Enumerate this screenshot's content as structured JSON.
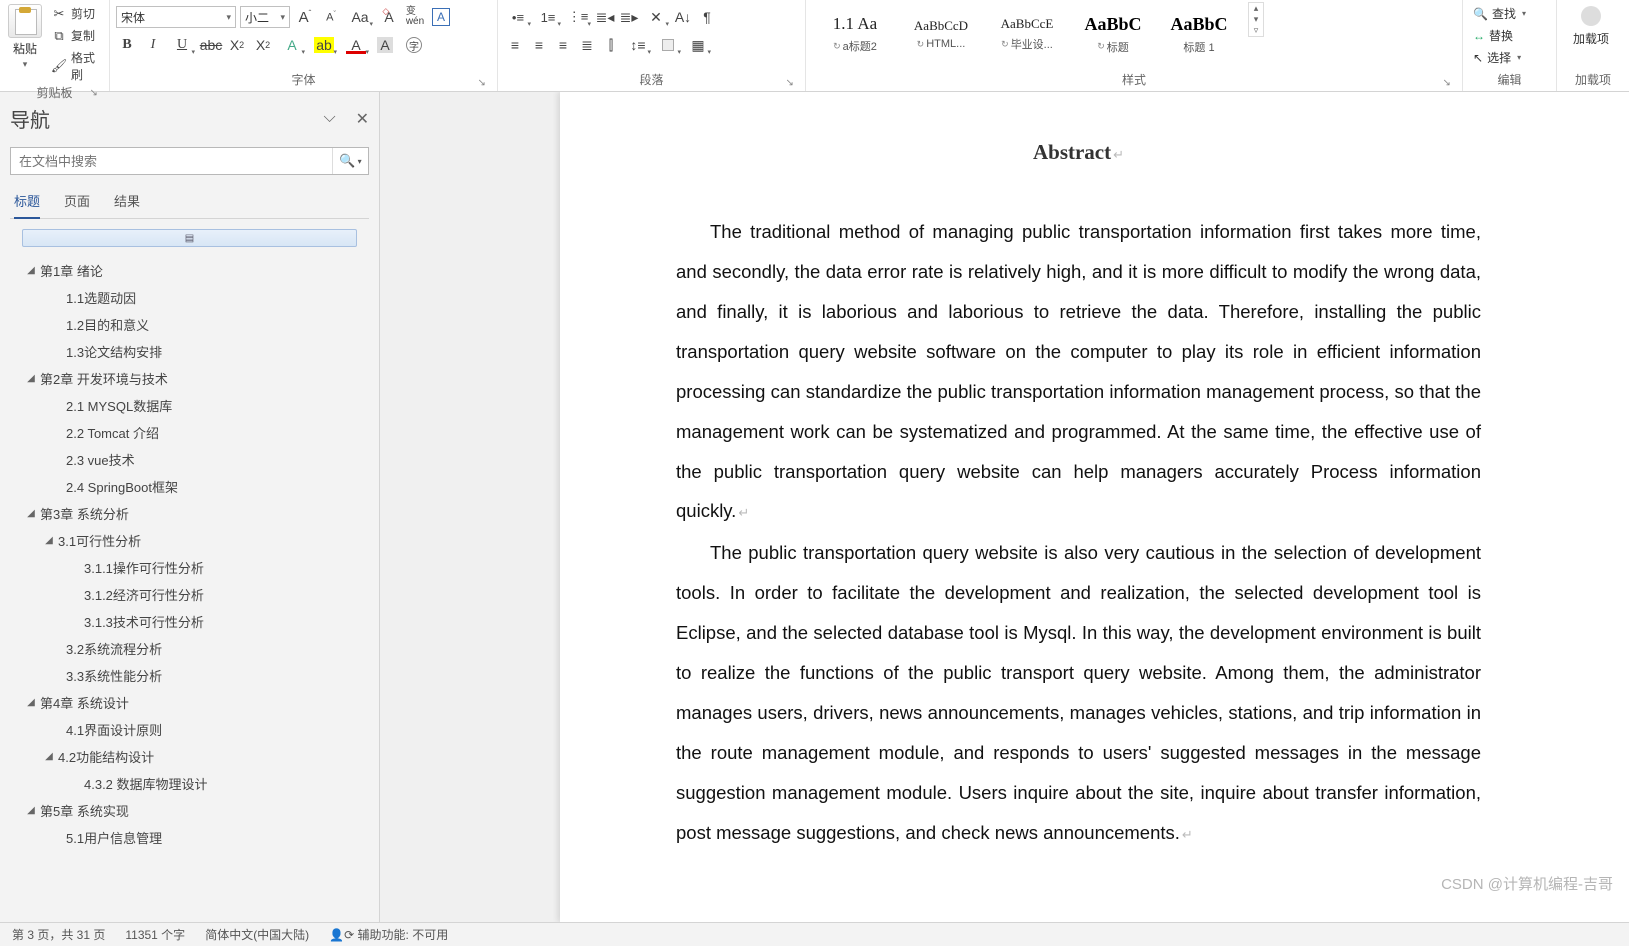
{
  "ribbon": {
    "clipboard": {
      "label": "剪贴板",
      "paste": "粘贴",
      "cut": "剪切",
      "copy": "复制",
      "formatPainter": "格式刷"
    },
    "font": {
      "label": "字体",
      "fontName": "宋体",
      "fontSize": "小二",
      "btns": {
        "bold": "B",
        "italic": "I",
        "underline": "U",
        "strike": "abc",
        "sub": "X",
        "sup": "X",
        "grow": "A",
        "shrink": "A",
        "changeCase": "Aa",
        "phonetic": "wén",
        "charBorder": "A",
        "clearFmt": "A",
        "textEffects": "A",
        "highlight": "ab",
        "fontColor": "A",
        "charShading": "A"
      }
    },
    "paragraph": {
      "label": "段落"
    },
    "styles": {
      "label": "样式",
      "items": [
        {
          "preview": "1.1 Aa",
          "name": "a标题2",
          "size": "17px",
          "weight": "normal",
          "color": "#222",
          "refresh": true
        },
        {
          "preview": "AaBbCcD",
          "name": "HTML...",
          "size": "13px",
          "weight": "normal",
          "color": "#222",
          "refresh": true
        },
        {
          "preview": "AaBbCcE",
          "name": "毕业设...",
          "size": "13px",
          "weight": "normal",
          "color": "#222",
          "refresh": true
        },
        {
          "preview": "AaBbC",
          "name": "标题",
          "size": "18px",
          "weight": "bold",
          "color": "#000",
          "refresh": true
        },
        {
          "preview": "AaBbC",
          "name": "标题 1",
          "size": "18px",
          "weight": "bold",
          "color": "#000",
          "refresh": false
        }
      ]
    },
    "editing": {
      "label": "编辑",
      "find": "查找",
      "replace": "替换",
      "select": "选择"
    },
    "addins": {
      "label": "加载项",
      "button": "加载项"
    }
  },
  "nav": {
    "title": "导航",
    "searchPlaceholder": "在文档中搜索",
    "tabs": {
      "headings": "标题",
      "pages": "页面",
      "results": "结果"
    },
    "jump": "▤",
    "tree": [
      {
        "lvl": "lvl1exp",
        "toggle": "◢",
        "label": "第1章 绪论"
      },
      {
        "lvl": "lvl2",
        "label": "1.1选题动因"
      },
      {
        "lvl": "lvl2",
        "label": "1.2目的和意义"
      },
      {
        "lvl": "lvl2",
        "label": "1.3论文结构安排"
      },
      {
        "lvl": "lvl1exp",
        "toggle": "◢",
        "label": "第2章 开发环境与技术"
      },
      {
        "lvl": "lvl2",
        "label": "2.1 MYSQL数据库"
      },
      {
        "lvl": "lvl2",
        "label": "2.2 Tomcat 介绍"
      },
      {
        "lvl": "lvl2",
        "label": "2.3 vue技术"
      },
      {
        "lvl": "lvl2",
        "label": "2.4 SpringBoot框架"
      },
      {
        "lvl": "lvl1exp",
        "toggle": "◢",
        "label": "第3章 系统分析"
      },
      {
        "lvl": "lvl2exp",
        "toggle": "◢",
        "label": "3.1可行性分析"
      },
      {
        "lvl": "lvl3",
        "label": "3.1.1操作可行性分析"
      },
      {
        "lvl": "lvl3",
        "label": "3.1.2经济可行性分析"
      },
      {
        "lvl": "lvl3",
        "label": "3.1.3技术可行性分析"
      },
      {
        "lvl": "lvl2",
        "label": "3.2系统流程分析"
      },
      {
        "lvl": "lvl2",
        "label": "3.3系统性能分析"
      },
      {
        "lvl": "lvl1exp",
        "toggle": "◢",
        "label": "第4章 系统设计"
      },
      {
        "lvl": "lvl2",
        "label": "4.1界面设计原则"
      },
      {
        "lvl": "lvl2exp",
        "toggle": "◢",
        "label": "4.2功能结构设计"
      },
      {
        "lvl": "lvl3",
        "label": "4.3.2 数据库物理设计"
      },
      {
        "lvl": "lvl1exp",
        "toggle": "◢",
        "label": "第5章 系统实现"
      },
      {
        "lvl": "lvl2",
        "label": "5.1用户信息管理"
      }
    ]
  },
  "document": {
    "title": "Abstract",
    "p1": "The traditional method of managing public transportation information first takes more time, and secondly, the data error rate is relatively high, and it is more difficult to modify the wrong data, and finally, it is laborious and laborious to retrieve the data. Therefore, installing the public transportation query website software on the computer to play its role in efficient information processing can standardize the public transportation information management process, so that the management work can be systematized and programmed. At the same time, the effective use of the public transportation query website can help managers accurately Process information quickly.",
    "p2": "The public transportation query website is also very cautious in the selection of development tools. In order to facilitate the development and realization, the selected development tool is Eclipse, and the selected database tool is Mysql. In this way, the development environment is built to realize the functions of the public transport query website. Among them, the administrator manages users, drivers, news announcements, manages vehicles, stations, and trip information in the route management module, and responds to users' suggested messages in the message suggestion management module. Users inquire about the site, inquire about transfer information, post message suggestions, and check news announcements."
  },
  "status": {
    "page": "第 3 页，共 31 页",
    "words": "11351 个字",
    "lang": "简体中文(中国大陆)",
    "access": "辅助功能: 不可用"
  },
  "watermark": "CSDN @计算机编程-吉哥"
}
